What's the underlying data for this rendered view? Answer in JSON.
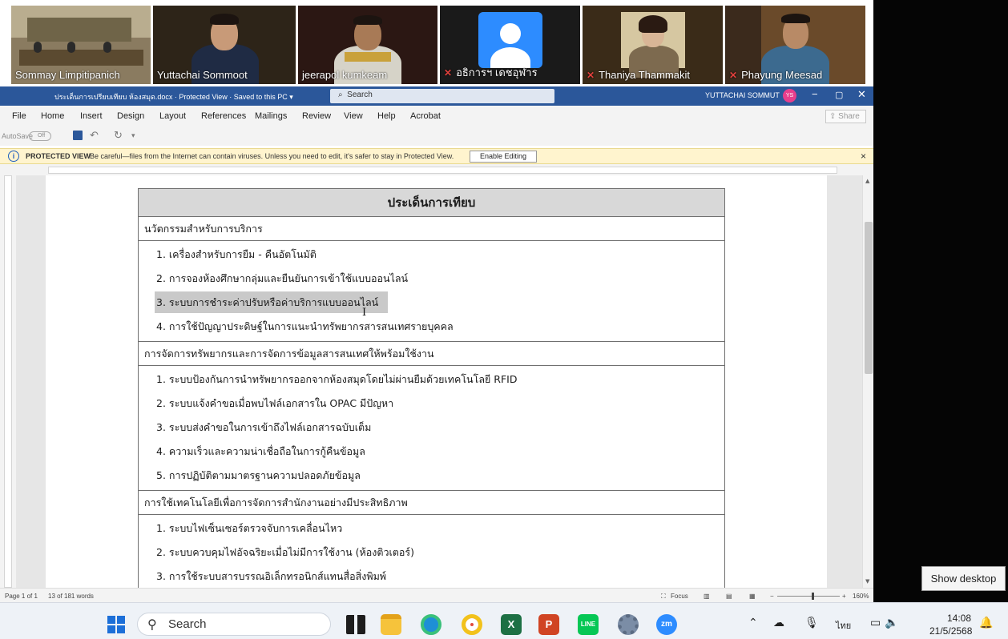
{
  "participants": [
    {
      "name": "Sommay Limpitipanich",
      "muted": false,
      "active": false
    },
    {
      "name": "Yuttachai Sommoot",
      "muted": false,
      "active": true
    },
    {
      "name": "jeerapol kumkeam",
      "muted": false,
      "active": false
    },
    {
      "name": "อธิการฯ เดชอุฬาร",
      "muted": true,
      "active": false
    },
    {
      "name": "Thaniya Thammakit",
      "muted": true,
      "active": false
    },
    {
      "name": "Phayung Meesad",
      "muted": true,
      "active": false
    }
  ],
  "word": {
    "doc_title": "ประเด็นการเปรียบเทียบ ห้องสมุด.docx  ·  Protected View  ·  Saved to this PC ▾",
    "search_placeholder": "Search",
    "user_name": "YUTTACHAI SOMMUT",
    "user_initials": "YS",
    "menu": [
      "File",
      "Home",
      "Insert",
      "Design",
      "Layout",
      "References",
      "Mailings",
      "Review",
      "View",
      "Help",
      "Acrobat"
    ],
    "share_label": "Share",
    "autosave_label": "AutoSave",
    "autosave_state": "Off",
    "protected_label": "PROTECTED VIEW",
    "protected_message": "Be careful—files from the Internet can contain viruses. Unless you need to edit, it's safer to stay in Protected View.",
    "enable_editing_label": "Enable Editing",
    "status": {
      "page": "Page 1 of 1",
      "words": "13 of 181 words",
      "focus": "Focus",
      "zoom": "160%"
    }
  },
  "document": {
    "header": "ประเด็นการเทียบ",
    "sections": [
      {
        "title": "นวัตกรรมสำหรับการบริการ",
        "items": [
          "1. เครื่องสำหรับการยืม - คืนอัตโนมัติ",
          "2. การจองห้องศึกษากลุ่มและยืนยันการเข้าใช้แบบออนไลน์",
          "3. ระบบการชำระค่าปรับหรือค่าบริการแบบออนไลน์",
          "4. การใช้ปัญญาประดิษฐ์ในการแนะนำทรัพยากรสารสนเทศรายบุคคล"
        ],
        "selected_index": 2
      },
      {
        "title": "การจัดการทรัพยากรและการจัดการข้อมูลสารสนเทศให้พร้อมใช้งาน",
        "items": [
          "1. ระบบป้องกันการนำทรัพยากรออกจากห้องสมุดโดยไม่ผ่านยืมด้วยเทคโนโลยี RFID",
          "2. ระบบแจ้งคำขอเมื่อพบไฟล์เอกสารใน OPAC มีปัญหา",
          "3. ระบบส่งคำขอในการเข้าถึงไฟล์เอกสารฉบับเต็ม",
          "4. ความเร็วและความน่าเชื่อถือในการกู้คืนข้อมูล",
          "5. การปฏิบัติตามมาตรฐานความปลอดภัยข้อมูล"
        ]
      },
      {
        "title": "การใช้เทคโนโลยีเพื่อการจัดการสำนักงานอย่างมีประสิทธิภาพ",
        "items": [
          "1. ระบบไฟเซ็นเซอร์ตรวจจับการเคลื่อนไหว",
          "2. ระบบควบคุมไฟอัจฉริยะเมื่อไม่มีการใช้งาน (ห้องติวเตอร์)",
          "3. การใช้ระบบสารบรรณอิเล็กทรอนิกส์แทนสื่อสิ่งพิมพ์"
        ]
      }
    ]
  },
  "desktop": {
    "show_desktop_tooltip": "Show desktop"
  },
  "taskbar": {
    "search_placeholder": "Search",
    "language": "ไทย",
    "time": "14:08",
    "date": "21/5/2568"
  }
}
